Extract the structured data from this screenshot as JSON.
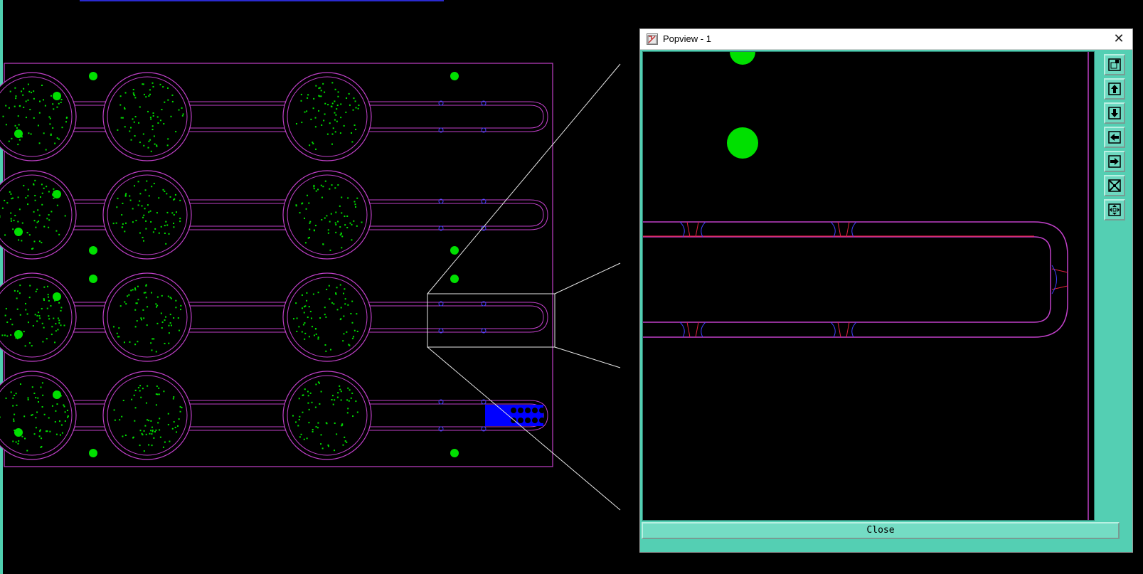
{
  "window": {
    "title": "Popview - 1",
    "close_glyph": "✕",
    "close_label": "Close"
  },
  "toolbar": {
    "tools": [
      {
        "name": "zoom-fit-icon"
      },
      {
        "name": "pan-up-icon"
      },
      {
        "name": "pan-down-icon"
      },
      {
        "name": "pan-left-icon"
      },
      {
        "name": "pan-right-icon"
      },
      {
        "name": "zoom-out-icon"
      },
      {
        "name": "zoom-in-icon"
      }
    ]
  },
  "colors": {
    "background": "#000000",
    "outline": "#c040c8",
    "copper": "#00e000",
    "highlight": "#0000ff",
    "trace_red": "#e02040",
    "panel": "#54cfb3"
  }
}
